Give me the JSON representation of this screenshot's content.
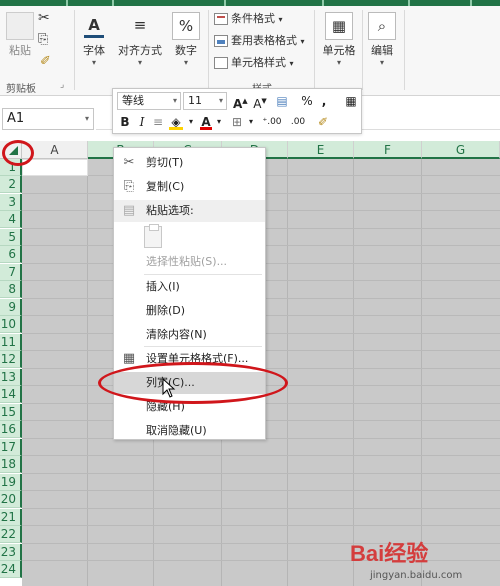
{
  "ribbon": {
    "clipboard": {
      "paste_label": "粘贴",
      "group_label": "剪贴板"
    },
    "font_label": "字体",
    "alignment_label": "对齐方式",
    "number_label": "数字",
    "styles": {
      "conditional_format": "条件格式",
      "table_format": "套用表格格式",
      "cell_styles": "单元格样式",
      "group_label": "样式"
    },
    "cells_label": "单元格",
    "editing_label": "编辑"
  },
  "formula_bar": {
    "name_box": "A1"
  },
  "mini_toolbar": {
    "font_name": "等线",
    "font_size": "11",
    "bold": "B",
    "italic": "I",
    "percent": "%",
    "comma": ","
  },
  "grid": {
    "columns": [
      "A",
      "B",
      "C",
      "D",
      "E",
      "F",
      "G"
    ],
    "rows": [
      "1",
      "2",
      "3",
      "4",
      "5",
      "6",
      "7",
      "8",
      "9",
      "10",
      "11",
      "12",
      "13",
      "14",
      "15",
      "16",
      "17",
      "18",
      "19",
      "20",
      "21",
      "22",
      "23",
      "24"
    ]
  },
  "context_menu": {
    "items": [
      {
        "label": "剪切(T)",
        "icon": "scissors-icon"
      },
      {
        "label": "复制(C)",
        "icon": "copy-icon"
      },
      {
        "label": "粘贴选项:",
        "icon": "paste-icon"
      },
      {
        "label": "选择性粘贴(S)..."
      },
      {
        "label": "插入(I)"
      },
      {
        "label": "删除(D)"
      },
      {
        "label": "清除内容(N)"
      },
      {
        "label": "设置单元格格式(F)...",
        "icon": "format-cells-icon"
      },
      {
        "label": "列宽(C)..."
      },
      {
        "label": "隐藏(H)"
      },
      {
        "label": "取消隐藏(U)"
      }
    ]
  },
  "colors": {
    "excel_green": "#217346",
    "annotation_red": "#d0161b"
  },
  "watermark": {
    "brand": "Bai经验",
    "url": "jingyan.baidu.com"
  }
}
